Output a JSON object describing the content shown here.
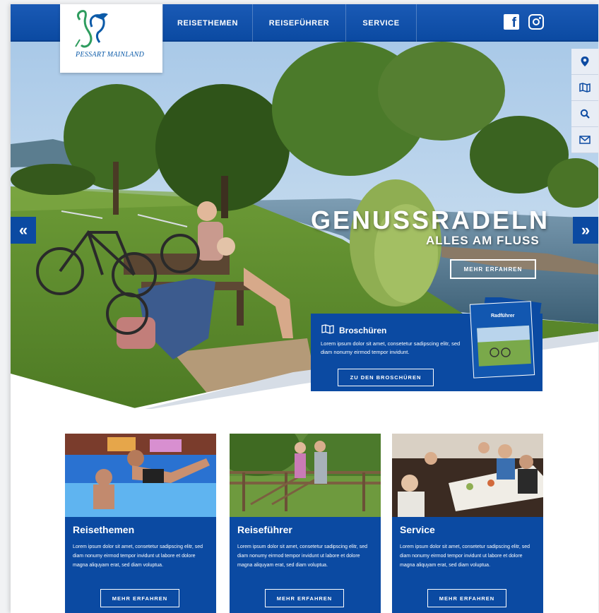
{
  "logo": {
    "text": "PESSART MAINLAND",
    "icon": "heron-logo-icon"
  },
  "nav": {
    "items": [
      {
        "label": "REISETHEMEN"
      },
      {
        "label": "REISEFÜHRER"
      },
      {
        "label": "SERVICE"
      }
    ],
    "social": [
      "facebook-icon",
      "instagram-icon"
    ]
  },
  "hero": {
    "title": "GENUSSRADELN",
    "subtitle": "ALLES AM FLUSS",
    "button": "MEHR ERFAHREN",
    "prev_icon": "«",
    "next_icon": "»"
  },
  "side_tools": [
    "location-icon",
    "map-icon",
    "search-icon",
    "mail-icon"
  ],
  "brochure": {
    "title": "Broschüren",
    "text": "Lorem ipsum dolor sit amet, consetetur sadipscing elitr, sed diam nonumy eirmod tempor invidunt.",
    "button": "ZU DEN BROSCHÜREN",
    "mag_title": "Radführer"
  },
  "cards": [
    {
      "title": "Reisethemen",
      "text": "Lorem ipsum dolor sit amet, consetetur sadipscing elitr, sed diam nonumy eirmod tempor invidunt ut labore et dolore magna aliquyam erat, sed diam voluptua.",
      "button": "MEHR ERFAHREN"
    },
    {
      "title": "Reiseführer",
      "text": "Lorem ipsum dolor sit amet, consetetur sadipscing elitr, sed diam nonumy eirmod tempor invidunt ut labore et dolore magna aliquyam erat, sed diam voluptua.",
      "button": "MEHR ERFAHREN"
    },
    {
      "title": "Service",
      "text": "Lorem ipsum dolor sit amet, consetetur sadipscing elitr, sed diam nonumy eirmod tempor invidunt ut labore et dolore magna aliquyam erat, sed diam voluptua.",
      "button": "MEHR ERFAHREN"
    }
  ],
  "colors": {
    "brand_blue": "#0b4aa2",
    "white": "#ffffff"
  }
}
